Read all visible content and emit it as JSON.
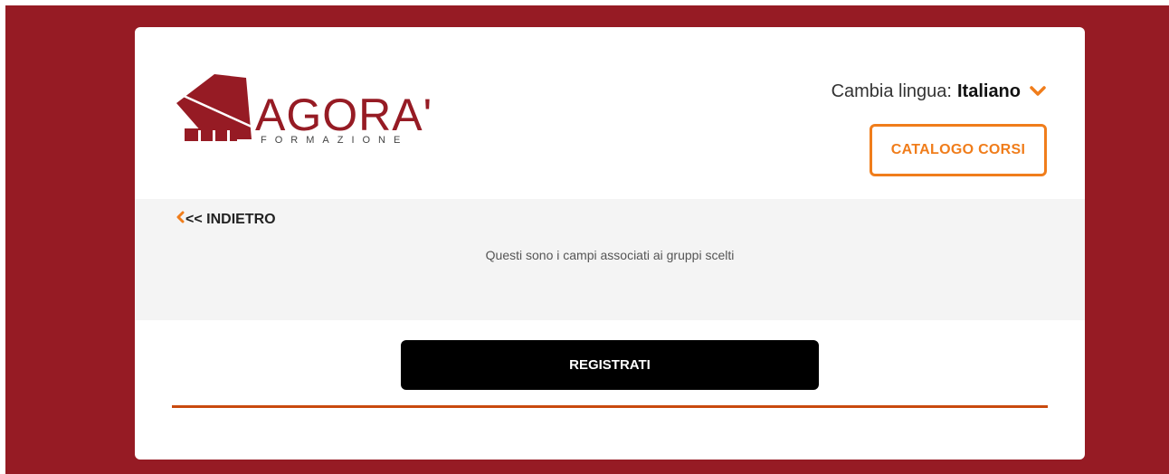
{
  "brand": {
    "name": "AGORA'",
    "tagline": "FORMAZIONE",
    "color": "#961b24"
  },
  "language": {
    "label": "Cambia lingua:",
    "selected": "Italiano",
    "icon": "chevron-down-icon"
  },
  "header": {
    "catalog_label": "CATALOGO CORSI"
  },
  "back_link": {
    "label": "<< INDIETRO",
    "icon": "chevron-left-icon"
  },
  "main": {
    "info_text": "Questi sono i campi associati ai gruppi scelti",
    "register_label": "REGISTRATI"
  },
  "colors": {
    "accent": "#f07d1b",
    "background": "#961b24",
    "divider": "#c94a0e",
    "button": "#000000"
  }
}
